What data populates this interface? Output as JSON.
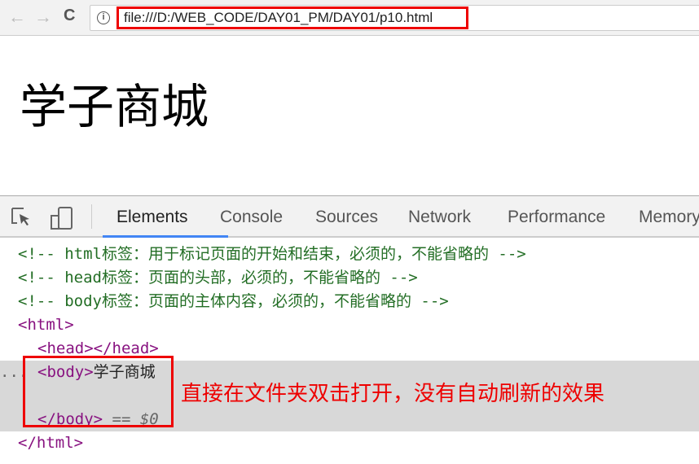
{
  "browser": {
    "back": "←",
    "forward": "→",
    "reload": "C",
    "info": "i",
    "url": "file:///D:/WEB_CODE/DAY01_PM/DAY01/p10.html"
  },
  "page": {
    "heading": "学子商城"
  },
  "devtools": {
    "tabs": [
      "Elements",
      "Console",
      "Sources",
      "Network",
      "Performance",
      "Memory"
    ],
    "lines": [
      "<!-- html标签：用于标记页面的开始和结束，必须的，不能省略的 -->",
      "<!-- head标签：页面的头部，必须的，不能省略的 -->",
      "<!-- body标签：页面的主体内容，必须的，不能省略的 -->"
    ],
    "html_open": "<html>",
    "head": "<head></head>",
    "body_open": "<body>",
    "body_text": "学子商城",
    "body_close": "</body>",
    "selected_marker": "== $0",
    "html_close": "</html>",
    "dots": "..."
  },
  "annotation": "直接在文件夹双击打开，没有自动刷新的效果"
}
